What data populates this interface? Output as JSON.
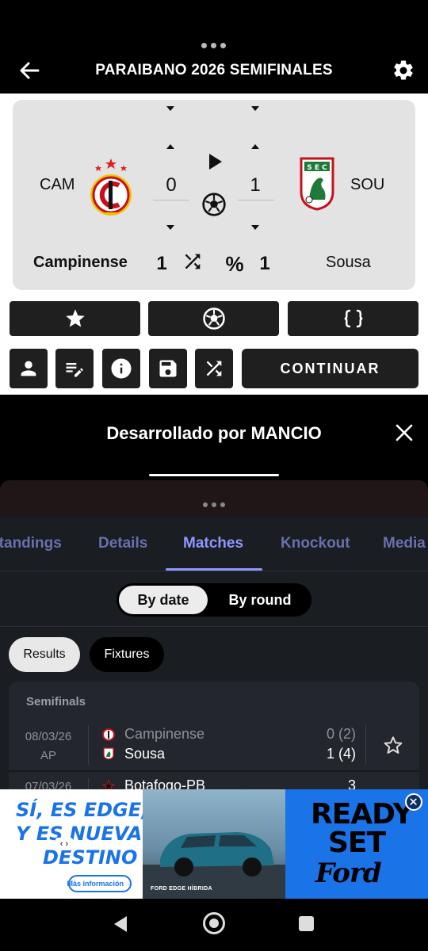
{
  "app": {
    "title": "PARAIBANO 2026 SEMIFINALES",
    "back_icon": "arrow-left-icon",
    "settings_icon": "gear-icon"
  },
  "scoreboard": {
    "home_abbr": "CAM",
    "away_abbr": "SOU",
    "home_score": "0",
    "away_score": "1",
    "home_name": "Campinense",
    "away_name": "Sousa",
    "home_stat": "1",
    "away_stat": "1",
    "percent_symbol": "%"
  },
  "actions": {
    "continue_label": "CONTINUAR"
  },
  "dev_banner": {
    "text": "Desarrollado por MANCIO"
  },
  "tabs": [
    {
      "label": "Standings"
    },
    {
      "label": "Details"
    },
    {
      "label": "Matches"
    },
    {
      "label": "Knockout"
    },
    {
      "label": "Media"
    }
  ],
  "view_toggle": {
    "by_date": "By date",
    "by_round": "By round"
  },
  "filters": {
    "results": "Results",
    "fixtures": "Fixtures"
  },
  "matches": {
    "round": "Semifinals",
    "items": [
      {
        "date": "08/03/26",
        "status": "AP",
        "home": "Campinense",
        "away": "Sousa",
        "home_score": "0",
        "home_pens": "(2)",
        "away_score": "1",
        "away_pens": "(4)"
      },
      {
        "date": "07/03/26",
        "home": "Botafogo-PB",
        "home_score": "3"
      }
    ]
  },
  "ad": {
    "left_line1": "SÍ, ES",
    "left_line1b": "EDGE,",
    "left_line2": "Y ES",
    "left_line2b": "NUEVA",
    "left_line3": "DESTINO",
    "cta": "Más información →",
    "caption": "FORD EDGE HÍBRIDA",
    "right_line1": "READY",
    "right_line2": "SET",
    "right_line3": "Ford"
  },
  "colors": {
    "accent": "#8f97ff",
    "tab_inactive": "#6a6fb0",
    "ad_blue": "#1b73e8",
    "card_bg": "#23272d"
  }
}
